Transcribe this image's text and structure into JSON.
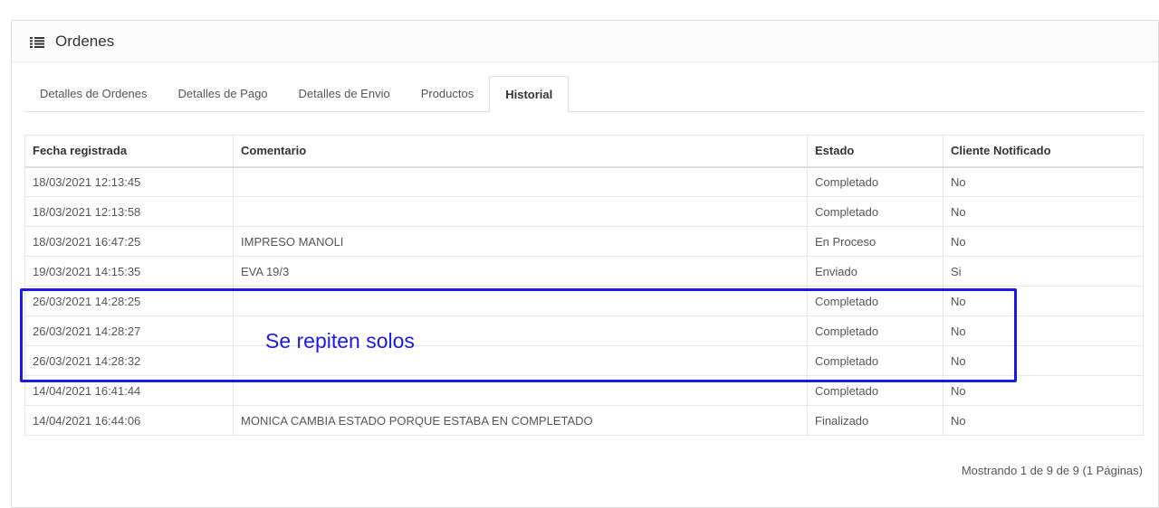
{
  "panel": {
    "title": "Ordenes",
    "icon": "list-icon"
  },
  "tabs": [
    {
      "label": "Detalles de Ordenes",
      "active": false
    },
    {
      "label": "Detalles de Pago",
      "active": false
    },
    {
      "label": "Detalles de Envio",
      "active": false
    },
    {
      "label": "Productos",
      "active": false
    },
    {
      "label": "Historial",
      "active": true
    }
  ],
  "table": {
    "headers": [
      "Fecha registrada",
      "Comentario",
      "Estado",
      "Cliente Notificado"
    ],
    "rows": [
      [
        "18/03/2021 12:13:45",
        "",
        "Completado",
        "No"
      ],
      [
        "18/03/2021 12:13:58",
        "",
        "Completado",
        "No"
      ],
      [
        "18/03/2021 16:47:25",
        "IMPRESO MANOLI",
        "En Proceso",
        "No"
      ],
      [
        "19/03/2021 14:15:35",
        "EVA 19/3",
        "Enviado",
        "Si"
      ],
      [
        "26/03/2021 14:28:25",
        "",
        "Completado",
        "No"
      ],
      [
        "26/03/2021 14:28:27",
        "",
        "Completado",
        "No"
      ],
      [
        "26/03/2021 14:28:32",
        "",
        "Completado",
        "No"
      ],
      [
        "14/04/2021 16:41:44",
        "",
        "Completado",
        "No"
      ],
      [
        "14/04/2021 16:44:06",
        "MONICA CAMBIA ESTADO PORQUE ESTABA EN COMPLETADO",
        "Finalizado",
        "No"
      ]
    ]
  },
  "pagination": {
    "info": "Mostrando 1 de 9 de 9 (1 Páginas)"
  },
  "annotation": {
    "text": "Se repiten solos",
    "color": "#1a1ae6"
  }
}
